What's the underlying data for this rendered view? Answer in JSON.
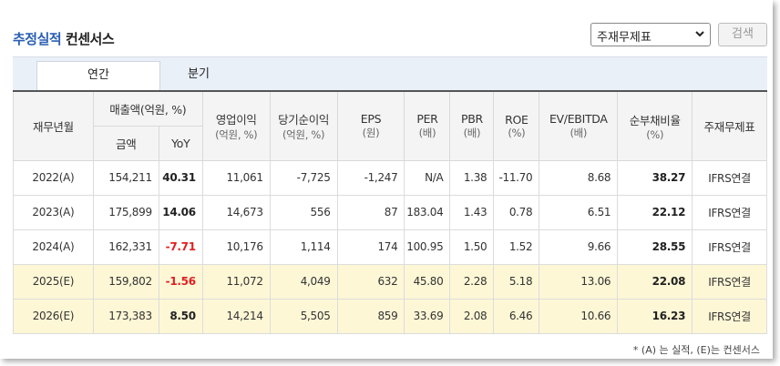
{
  "header": {
    "title_highlight": "추정실적",
    "title_rest": "컨센서스",
    "select_value": "주재무제표",
    "search_label": "검색"
  },
  "tabs": [
    {
      "label": "연간",
      "active": true
    },
    {
      "label": "분기",
      "active": false
    }
  ],
  "columns": {
    "period": "재무년월",
    "sales_group": "매출액(억원, %)",
    "sales_amount": "금액",
    "sales_yoy": "YoY",
    "op_income": "영업이익",
    "op_income_unit": "(억원, %)",
    "net_income": "당기순이익",
    "net_income_unit": "(억원, %)",
    "eps": "EPS",
    "eps_unit": "(원)",
    "per": "PER",
    "per_unit": "(배)",
    "pbr": "PBR",
    "pbr_unit": "(배)",
    "roe": "ROE",
    "roe_unit": "(%)",
    "ev_ebitda": "EV/EBITDA",
    "ev_ebitda_unit": "(배)",
    "net_debt_ratio": "순부채비율",
    "net_debt_ratio_unit": "(%)",
    "statement": "주재무제표"
  },
  "rows": [
    {
      "period": "2022(A)",
      "sales": "154,211",
      "yoy": "40.31",
      "op": "11,061",
      "net": "-7,725",
      "eps": "-1,247",
      "per": "N/A",
      "pbr": "1.38",
      "roe": "-11.70",
      "ev": "8.68",
      "debt": "38.27",
      "acct": "IFRS연결"
    },
    {
      "period": "2023(A)",
      "sales": "175,899",
      "yoy": "14.06",
      "op": "14,673",
      "net": "556",
      "eps": "87",
      "per": "183.04",
      "pbr": "1.43",
      "roe": "0.78",
      "ev": "6.51",
      "debt": "22.12",
      "acct": "IFRS연결"
    },
    {
      "period": "2024(A)",
      "sales": "162,331",
      "yoy": "-7.71",
      "op": "10,176",
      "net": "1,114",
      "eps": "174",
      "per": "100.95",
      "pbr": "1.50",
      "roe": "1.52",
      "ev": "9.66",
      "debt": "28.55",
      "acct": "IFRS연결"
    },
    {
      "period": "2025(E)",
      "sales": "159,802",
      "yoy": "-1.56",
      "op": "11,072",
      "net": "4,049",
      "eps": "632",
      "per": "45.80",
      "pbr": "2.28",
      "roe": "5.18",
      "ev": "13.06",
      "debt": "22.08",
      "acct": "IFRS연결"
    },
    {
      "period": "2026(E)",
      "sales": "173,383",
      "yoy": "8.50",
      "op": "14,214",
      "net": "5,505",
      "eps": "859",
      "per": "33.69",
      "pbr": "2.08",
      "roe": "6.46",
      "ev": "10.66",
      "debt": "16.23",
      "acct": "IFRS연결"
    }
  ],
  "footnote": "* (A) 는 실적, (E)는 컨센서스",
  "colors": {
    "accent": "#2b5fb4",
    "negative": "#e02020",
    "estimate_row": "#fdf7d6"
  }
}
